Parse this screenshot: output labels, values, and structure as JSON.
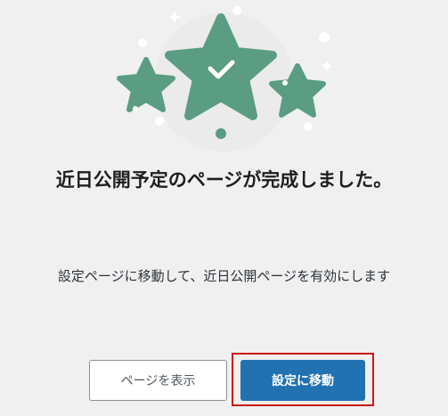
{
  "dialog": {
    "title": "近日公開予定のページが完成しました。",
    "description": "設定ページに移動して、近日公開ページを有効にします"
  },
  "actions": {
    "view_page_label": "ページを表示",
    "go_to_settings_label": "設定に移動"
  },
  "colors": {
    "background": "#f0f0f1",
    "star_green": "#5a9d82",
    "primary_blue": "#2271b1",
    "highlight_red": "#cc1818"
  },
  "icons": [
    "star-icon",
    "check-icon",
    "sparkle-icon"
  ]
}
